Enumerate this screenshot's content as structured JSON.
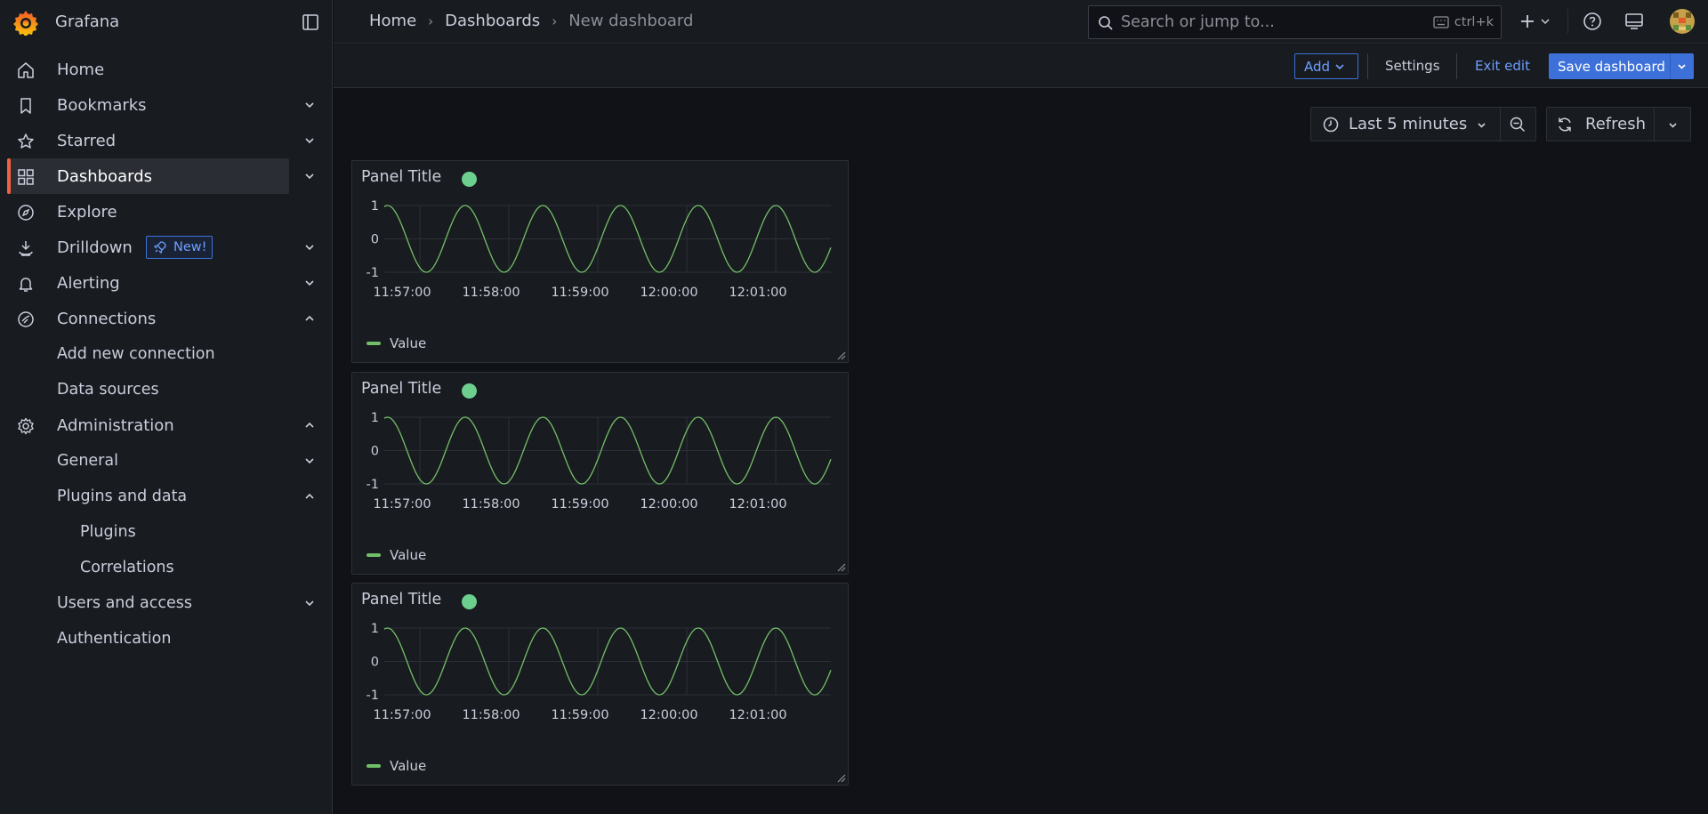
{
  "app": {
    "name": "Grafana"
  },
  "sidebar": {
    "items": [
      {
        "label": "Home"
      },
      {
        "label": "Bookmarks"
      },
      {
        "label": "Starred"
      },
      {
        "label": "Dashboards"
      },
      {
        "label": "Explore"
      },
      {
        "label": "Drilldown",
        "badge": "New!"
      },
      {
        "label": "Alerting"
      },
      {
        "label": "Connections"
      },
      {
        "label": "Add new connection"
      },
      {
        "label": "Data sources"
      },
      {
        "label": "Administration"
      },
      {
        "label": "General"
      },
      {
        "label": "Plugins and data"
      },
      {
        "label": "Plugins"
      },
      {
        "label": "Correlations"
      },
      {
        "label": "Users and access"
      },
      {
        "label": "Authentication"
      }
    ]
  },
  "breadcrumb": [
    "Home",
    "Dashboards",
    "New dashboard"
  ],
  "search": {
    "placeholder": "Search or jump to...",
    "shortcut": "ctrl+k"
  },
  "toolbar": {
    "add_label": "Add",
    "settings_label": "Settings",
    "exit_label": "Exit edit",
    "save_label": "Save dashboard"
  },
  "time": {
    "range_label": "Last 5 minutes",
    "refresh_label": "Refresh"
  },
  "colors": {
    "accent": "#3d71d9",
    "series": "#73bf69",
    "active_bar": "#f55f3e",
    "status_dot": "#6ccf8e"
  },
  "panels": [
    {
      "title": "Panel Title",
      "legend": "Value"
    },
    {
      "title": "Panel Title",
      "legend": "Value"
    },
    {
      "title": "Panel Title",
      "legend": "Value"
    }
  ],
  "chart_data": [
    {
      "type": "line",
      "title": "Panel Title",
      "x_ticks": [
        "11:57:00",
        "11:58:00",
        "11:59:00",
        "12:00:00",
        "12:01:00"
      ],
      "y_ticks": [
        "1",
        "0",
        "-1"
      ],
      "ylim": [
        -1,
        1
      ],
      "series": [
        {
          "name": "Value",
          "shape": "sine",
          "cycles": 5.75,
          "start_phase_deg": 75
        }
      ]
    },
    {
      "type": "line",
      "title": "Panel Title",
      "x_ticks": [
        "11:57:00",
        "11:58:00",
        "11:59:00",
        "12:00:00",
        "12:01:00"
      ],
      "y_ticks": [
        "1",
        "0",
        "-1"
      ],
      "ylim": [
        -1,
        1
      ],
      "series": [
        {
          "name": "Value",
          "shape": "sine",
          "cycles": 5.75,
          "start_phase_deg": 75
        }
      ]
    },
    {
      "type": "line",
      "title": "Panel Title",
      "x_ticks": [
        "11:57:00",
        "11:58:00",
        "11:59:00",
        "12:00:00",
        "12:01:00"
      ],
      "y_ticks": [
        "1",
        "0",
        "-1"
      ],
      "ylim": [
        -1,
        1
      ],
      "series": [
        {
          "name": "Value",
          "shape": "sine",
          "cycles": 5.75,
          "start_phase_deg": 75
        }
      ]
    }
  ]
}
